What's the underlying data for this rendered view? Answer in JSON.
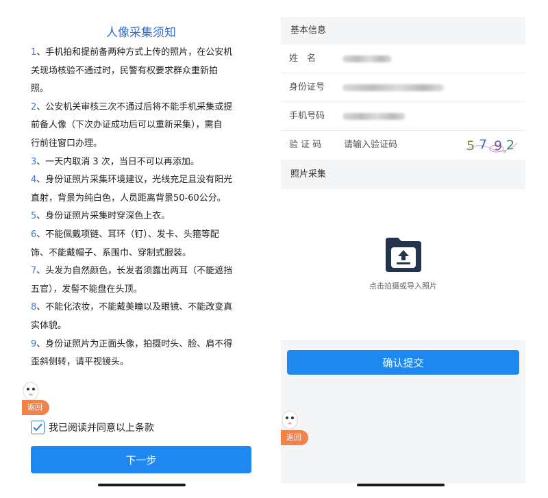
{
  "notice": {
    "title": "人像采集须知",
    "rules": [
      {
        "num": "1",
        "text": "、手机拍和提前备两种方式上传的照片，在公安机"
      },
      {
        "num": "",
        "text": "关现场核验不通过时，民警有权要求群众重新拍"
      },
      {
        "num": "",
        "text": "照。"
      },
      {
        "num": "2",
        "text": "、公安机关审核三次不通过后将不能手机采集或提"
      },
      {
        "num": "",
        "text": "前备人像（下次办证成功后可以重新采集），需自"
      },
      {
        "num": "",
        "text": "行前往窗口办理。"
      },
      {
        "num": "3",
        "text": "、一天内取消 3 次，当日不可以再添加。"
      },
      {
        "num": "4",
        "text": "、身份证照片采集环境建议，光线充足且没有阳光"
      },
      {
        "num": "",
        "text": "直射，背景为纯白色，人员距离背景50-60公分。"
      },
      {
        "num": "5",
        "text": "、身份证照片采集时穿深色上衣。"
      },
      {
        "num": "6",
        "text": "、不能佩戴项链、耳环（钉）、发卡、头箍等配"
      },
      {
        "num": "",
        "text": "饰、不能戴帽子、系围巾、穿制式服装。"
      },
      {
        "num": "7",
        "text": "、头发为自然颜色，长发者须露出两耳（不能遮挡"
      },
      {
        "num": "",
        "text": "五官），发髻不能盘在头顶。"
      },
      {
        "num": "8",
        "text": "、不能化浓妆，不能戴美瞳以及眼镜、不能改变真"
      },
      {
        "num": "",
        "text": "实体貌。"
      },
      {
        "num": "9",
        "text": "、身份证照片为正面头像，拍摄时头、脸、肩不得"
      },
      {
        "num": "",
        "text": "歪斜侧转，请平视镜头。"
      }
    ],
    "back_label": "返回",
    "agree_label": "我已阅读并同意以上条款",
    "agree_checked": true,
    "next_label": "下一步"
  },
  "form": {
    "basic_section": "基本信息",
    "name_label": "姓　名",
    "id_label": "身份证号",
    "phone_label": "手机号码",
    "captcha_label": "验 证 码",
    "captcha_placeholder": "请输入验证码",
    "captcha_value": "5792",
    "photo_section": "照片采集",
    "upload_hint": "点击拍摄或导入照片",
    "submit_label": "确认提交",
    "back_label": "返回"
  },
  "colors": {
    "accent": "#1e88f0",
    "link_blue": "#2f6ad9",
    "back_orange": "#f2814a",
    "section_bg": "#f4f5f7"
  },
  "icons": {
    "upload": "folder-upload-icon",
    "check": "check-icon",
    "mascot": "mascot-icon"
  }
}
